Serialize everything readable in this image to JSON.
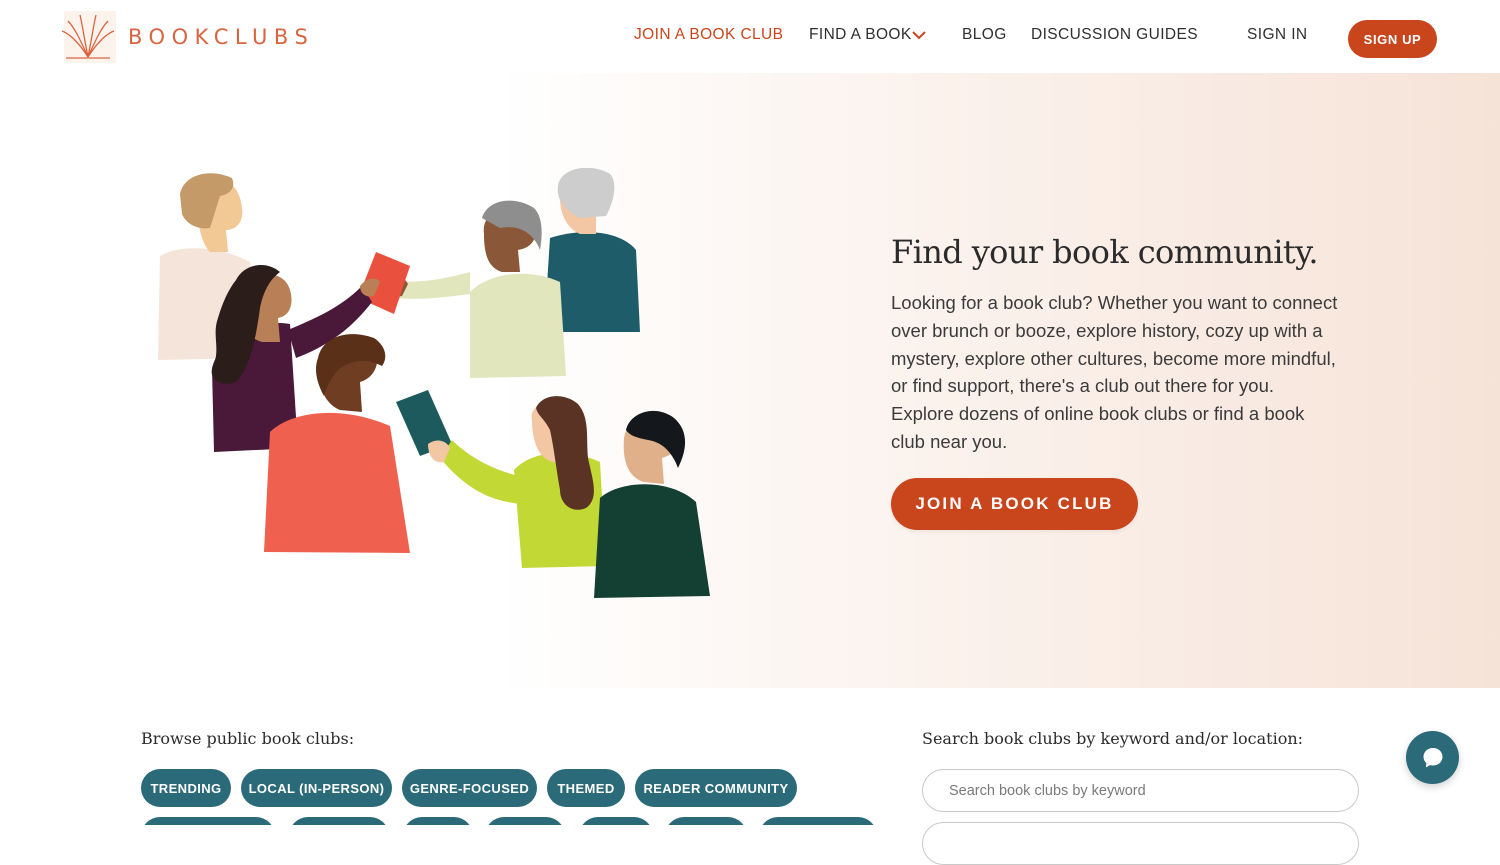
{
  "header": {
    "logo_text": "BOOKCLUBS",
    "nav": {
      "join": "JOIN A BOOK CLUB",
      "find": "FIND A BOOK",
      "blog": "BLOG",
      "guides": "DISCUSSION GUIDES",
      "signin": "SIGN IN"
    },
    "signup_label": "SIGN UP"
  },
  "hero": {
    "title": "Find your book community.",
    "text": "Looking for a book club? Whether you want to connect over brunch or booze, explore history, cozy up with a mystery, explore other cultures, become more mindful, or find support, there's a club out there for you. Explore dozens of online book clubs or find a book club near you.",
    "cta_label": "JOIN A BOOK CLUB"
  },
  "browse": {
    "label": "Browse public book clubs:",
    "chips": [
      "TRENDING",
      "LOCAL (IN-PERSON)",
      "GENRE-FOCUSED",
      "THEMED",
      "READER COMMUNITY"
    ]
  },
  "search": {
    "label": "Search book clubs by keyword and/or location:",
    "keyword_placeholder": "Search book clubs by keyword",
    "keyword_value": ""
  },
  "icons": {
    "logo": "book-fan-logo-icon",
    "find_dropdown": "chevron-down-icon",
    "chat": "chat-bubble-icon"
  },
  "colors": {
    "accent": "#c9461d",
    "teal": "#2b6a78",
    "logo": "#d9653f",
    "hero_gradient_end": "#f6e3d8"
  }
}
